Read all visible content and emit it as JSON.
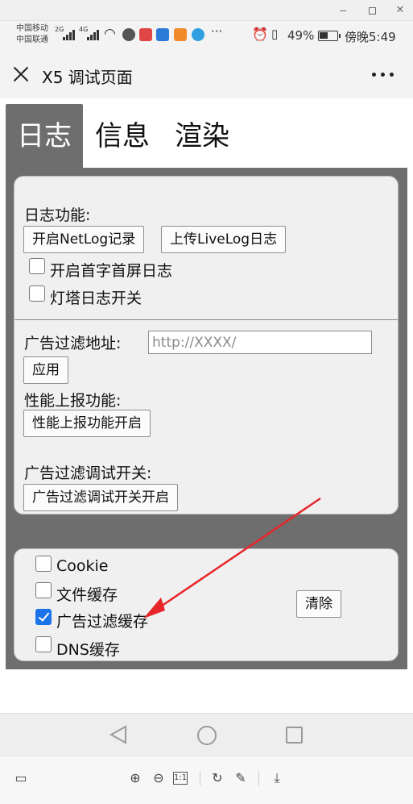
{
  "status_bar": {
    "carrier_1": "中国移动",
    "carrier_2": "中国联通",
    "signal_1": "2G",
    "signal_2": "4G",
    "battery": "49%",
    "time": "傍晚5:49"
  },
  "header": {
    "title": "X5 调试页面",
    "more_icon": "more-dots-icon",
    "close_icon": "close-icon"
  },
  "tabs": [
    {
      "label": "日志",
      "active": true
    },
    {
      "label": "信息",
      "active": false
    },
    {
      "label": "渲染",
      "active": false
    }
  ],
  "log_section": {
    "log_label": "日志功能:",
    "netlog_button": "开启NetLog记录",
    "livelog_button": "上传LiveLog日志",
    "first_screen_label": "开启首字首屏日志",
    "first_screen_checked": false,
    "beacon_label": "灯塔日志开关",
    "beacon_checked": false,
    "ad_filter_url_label": "广告过滤地址:",
    "ad_filter_url_placeholder": "http://XXXX/",
    "apply_button": "应用",
    "perf_label": "性能上报功能:",
    "perf_button": "性能上报功能开启",
    "ad_debug_label": "广告过滤调试开关:",
    "ad_debug_button": "广告过滤调试开关开启"
  },
  "cache_section": {
    "items": [
      {
        "label": "Cookie",
        "checked": false
      },
      {
        "label": "文件缓存",
        "checked": false
      },
      {
        "label": "广告过滤缓存",
        "checked": true
      },
      {
        "label": "DNS缓存",
        "checked": false
      }
    ],
    "clear_button": "清除"
  },
  "annotation": {
    "arrow_color": "#e8262a"
  },
  "colors": {
    "accent": "#1a73e8",
    "panel": "#6e6e6e"
  }
}
